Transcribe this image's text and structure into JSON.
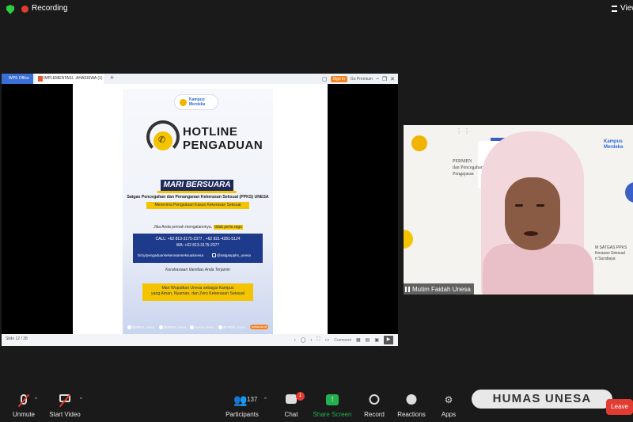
{
  "topbar": {
    "recording_label": "Recording",
    "view_label": "View",
    "security_icon": "shield-check-icon"
  },
  "share_window": {
    "app_tab": "WPS Office",
    "doc_tab": "IMPLEMENTASI...AHASISWA (1)",
    "signin_label": "Sign in",
    "premium_label": "Go Premium",
    "slide_counter": "Slide 12 / 28",
    "comment_label": "Comment"
  },
  "poster": {
    "brand": "Kampus Merdeka",
    "title_line1": "HOTLINE",
    "title_line2": "PENGADUAN",
    "slogan": "MARI BERSUARA",
    "org": "Satgas Pencegahan dan Penanganan Kekerasan Seksual (PPKS) UNESA",
    "banner": "Menerima Pengaduan Kasus Kekerasan Seksual",
    "prompt_prefix": "Jika Anda pernah mengalaminya,",
    "prompt_highlight": "tidak perlu ragu",
    "call": "CALL: +62 813-3175-2377 , +62 821-4281-5124",
    "wa": "WA: +62 813-3175-2377",
    "link": "bit.ly/pengaduankekerasanseksualunesa",
    "instagram": "@satgasppks_unesa",
    "confidential": "Kerahasiaan Identitas Anda Terjamin",
    "closing_line1": "Mari Wujudkan Unesa sebagai Kampus",
    "closing_line2": "yang Aman, Nyaman, dan Zero Kekerasan Seksual",
    "social": [
      "@Official_Unesa",
      "@Official_Unesa",
      "Humas Unesa",
      "@Official_Unesa",
      "unesa.ac.id"
    ]
  },
  "video": {
    "participant_name": "Mutim Faidah Unesa",
    "bg_text1": "PERMEN",
    "bg_text2": "dan Pencegahan",
    "bg_text3": "Pengajaran",
    "bg_text4": "ri Surabaya",
    "bg_text5": "M SATGAS PPKS",
    "bg_text6": "Kerasan Seksual",
    "bg_text7": "ri Surabaya",
    "bg_brand": "Kampus Merdeka"
  },
  "toolbar": {
    "unmute": "Unmute",
    "start_video": "Start Video",
    "participants": "Participants",
    "participant_count": "137",
    "chat": "Chat",
    "chat_badge": "1",
    "share_screen": "Share Screen",
    "record": "Record",
    "reactions": "Reactions",
    "apps": "Apps",
    "leave": "Leave"
  },
  "watermark": "HUMAS UNESA",
  "colors": {
    "recording_red": "#e03c31",
    "share_green": "#23b14d",
    "poster_yellow": "#f5c400",
    "poster_navy": "#1e3a8a"
  }
}
